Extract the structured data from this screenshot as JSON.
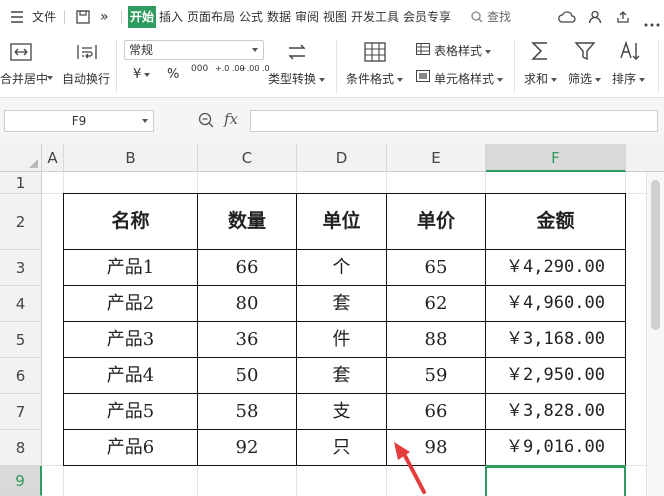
{
  "menubar": {
    "file": "文件",
    "more": "»",
    "tabs": [
      "开始",
      "插入",
      "页面布局",
      "公式",
      "数据",
      "审阅",
      "视图",
      "开发工具",
      "会员专享"
    ],
    "search": "查找"
  },
  "ribbon": {
    "merge_label": "合并居中",
    "wrap_label": "自动换行",
    "number_format": "常规",
    "currency": "¥",
    "percent": "%",
    "thousands": "000",
    "dec_increase": "+.0 .00",
    "dec_decrease": "+.00 .0",
    "type_convert": "类型转换",
    "conditional_format": "条件格式",
    "table_style": "表格样式",
    "cell_style": "单元格样式",
    "sum": "求和",
    "filter": "筛选",
    "sort": "排序"
  },
  "formula_bar": {
    "name_box": "F9",
    "fx": "fx",
    "formula": ""
  },
  "grid": {
    "columns": [
      "A",
      "B",
      "C",
      "D",
      "E",
      "F"
    ],
    "rows": [
      "1",
      "2",
      "3",
      "4",
      "5",
      "6",
      "7",
      "8",
      "9"
    ],
    "active_column": "F",
    "active_row": "9"
  },
  "table": {
    "headers": [
      "名称",
      "数量",
      "单位",
      "单价",
      "金额"
    ],
    "rows": [
      [
        "产品1",
        "66",
        "个",
        "65",
        "￥4,290.00"
      ],
      [
        "产品2",
        "80",
        "套",
        "62",
        "￥4,960.00"
      ],
      [
        "产品3",
        "36",
        "件",
        "88",
        "￥3,168.00"
      ],
      [
        "产品4",
        "50",
        "套",
        "59",
        "￥2,950.00"
      ],
      [
        "产品5",
        "58",
        "支",
        "66",
        "￥3,828.00"
      ],
      [
        "产品6",
        "92",
        "只",
        "98",
        "￥9,016.00"
      ]
    ]
  },
  "colors": {
    "accent": "#2e9c5e",
    "annotation_arrow": "#e23c3c"
  }
}
